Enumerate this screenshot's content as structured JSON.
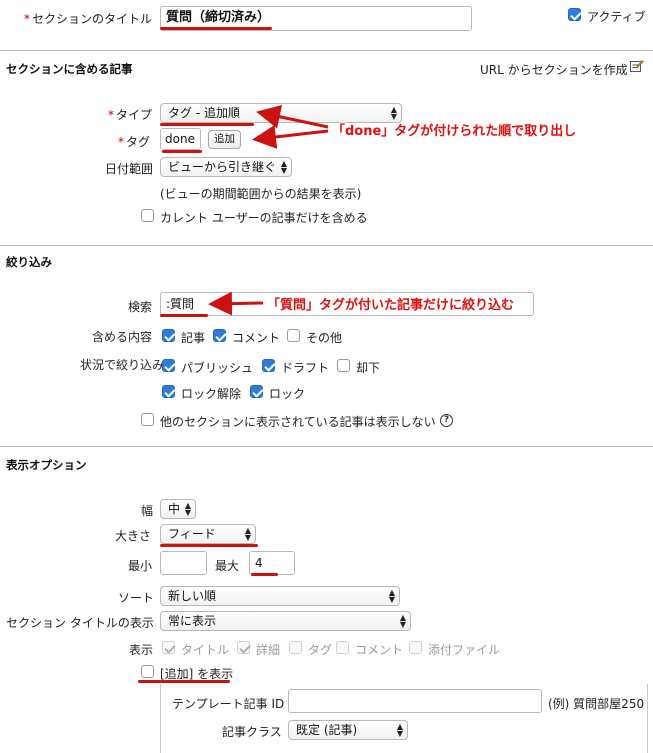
{
  "top": {
    "title_label": "セクションのタイトル",
    "title_value": "質問（締切済み）",
    "active_label": "アクティブ",
    "active_checked": true
  },
  "entries": {
    "header": "セクションに含める記事",
    "create_from_url": "URL からセクションを作成",
    "type_label": "タイプ",
    "type_value": "タグ - 追加順",
    "tag_label": "タグ",
    "tag_value": "done",
    "add_button": "追加",
    "date_label": "日付範囲",
    "date_value": "ビューから引き継ぐ",
    "date_note": "(ビューの期間範囲からの結果を表示)",
    "current_user_label": "カレント ユーザーの記事だけを含める",
    "annotation": "「done」タグが付けられた順で取り出し"
  },
  "filter": {
    "header": "絞り込み",
    "search_label": "検索",
    "search_value": ":質問",
    "annotation": "「質問」タグが付いた記事だけに絞り込む",
    "include_label": "含める内容",
    "include_options": [
      {
        "label": "記事",
        "checked": true
      },
      {
        "label": "コメント",
        "checked": true
      },
      {
        "label": "その他",
        "checked": false
      }
    ],
    "status_label": "状況で絞り込み",
    "status_options": [
      {
        "label": "パブリッシュ",
        "checked": true
      },
      {
        "label": "ドラフト",
        "checked": true
      },
      {
        "label": "却下",
        "checked": false
      },
      {
        "label": "ロック解除",
        "checked": true
      },
      {
        "label": "ロック",
        "checked": true
      }
    ],
    "hide_other_label": "他のセクションに表示されている記事は表示しない"
  },
  "display": {
    "header": "表示オプション",
    "width_label": "幅",
    "width_value": "中",
    "size_label": "大きさ",
    "size_value": "フィード",
    "min_label": "最小",
    "min_value": "",
    "max_label": "最大",
    "max_value": "4",
    "sort_label": "ソート",
    "sort_value": "新しい順",
    "title_display_label": "セクション タイトルの表示",
    "title_display_value": "常に表示",
    "show_label": "表示",
    "show_options": [
      {
        "label": "タイトル",
        "checked": true
      },
      {
        "label": "詳細",
        "checked": true
      },
      {
        "label": "タグ",
        "checked": false
      },
      {
        "label": "コメント",
        "checked": false
      },
      {
        "label": "添付ファイル",
        "checked": false
      }
    ],
    "show_add_label": "[追加] を表示",
    "template_label": "テンプレート記事 ID",
    "template_value": "",
    "template_example": "(例) 質問部屋250",
    "class_label": "記事クラス",
    "class_value": "既定 (記事)"
  },
  "colors": {
    "annotation_red": "#e01010",
    "checkbox_blue": "#2e7cd6"
  }
}
